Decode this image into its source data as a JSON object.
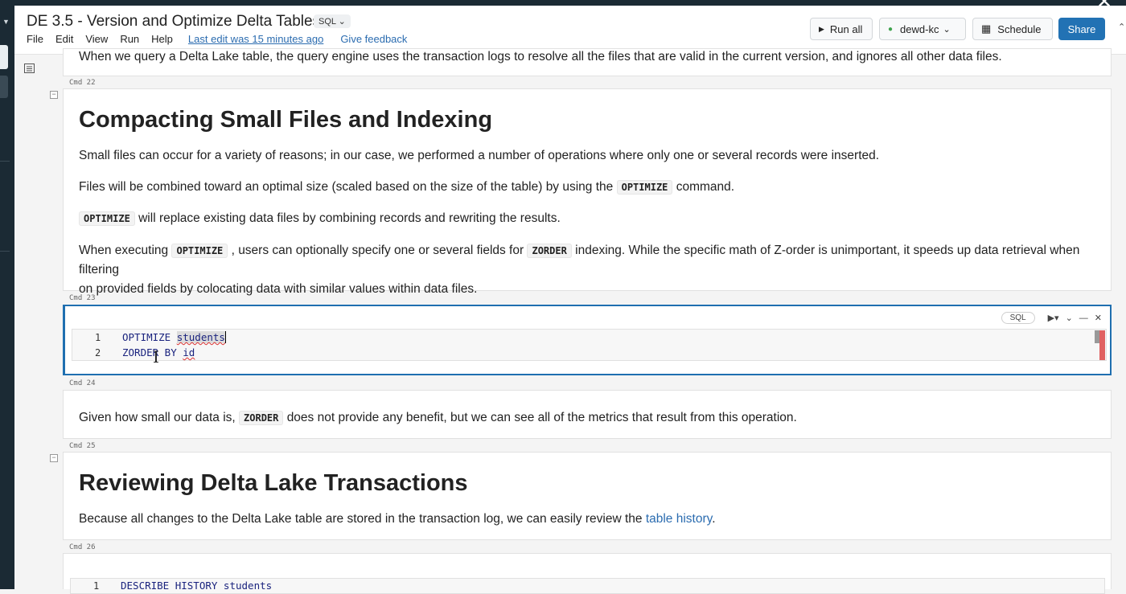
{
  "header": {
    "title": "DE 3.5 - Version and Optimize Delta Tables",
    "language": "SQL",
    "menu": [
      "File",
      "Edit",
      "View",
      "Run",
      "Help"
    ],
    "last_edit": "Last edit was 15 minutes ago",
    "feedback": "Give feedback",
    "run_all": "Run all",
    "cluster": "dewd-kc",
    "schedule": "Schedule",
    "share": "Share"
  },
  "cells": {
    "prev_text": "When we query a Delta Lake table, the query engine uses the transaction logs to resolve all the files that are valid in the current version, and ignores all other data files.",
    "cmd22": "Cmd 22",
    "h_compact": "Compacting Small Files and Indexing",
    "p1": "Small files can occur for a variety of reasons; in our case, we performed a number of operations where only one or several records were inserted.",
    "p2_a": "Files will be combined toward an optimal size (scaled based on the size of the table) by using the",
    "p2_code": "OPTIMIZE",
    "p2_b": "command.",
    "p3_code": "OPTIMIZE",
    "p3_b": "will replace existing data files by combining records and rewriting the results.",
    "p4_a": "When executing",
    "p4_code1": "OPTIMIZE",
    "p4_b": ", users can optionally specify one or several fields for",
    "p4_code2": "ZORDER",
    "p4_c": "indexing. While the specific math of Z-order is unimportant, it speeds up data retrieval when filtering",
    "p4_d": "on provided fields by colocating data with similar values within data files.",
    "cmd23": "Cmd 23",
    "code_lang": "SQL",
    "code_l1_n": "1",
    "code_l1_kw": "OPTIMIZE ",
    "code_l1_tbl": "students",
    "code_l2_n": "2",
    "code_l2_kw": "ZORDER BY ",
    "code_l2_col": "id",
    "cmd24": "Cmd 24",
    "p5_a": "Given how small our data is,",
    "p5_code": "ZORDER",
    "p5_b": "does not provide any benefit, but we can see all of the metrics that result from this operation.",
    "cmd25": "Cmd 25",
    "h_review": "Reviewing Delta Lake Transactions",
    "p6_a": "Because all changes to the Delta Lake table are stored in the transaction log, we can easily review the",
    "p6_link": "table history",
    "p6_b": ".",
    "cmd26": "Cmd 26",
    "code26_n": "1",
    "code26": "DESCRIBE HISTORY students"
  }
}
